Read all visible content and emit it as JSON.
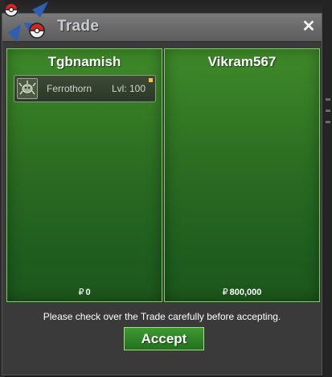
{
  "window": {
    "title": "Trade",
    "close_label": "✕"
  },
  "left_panel": {
    "name": "Tgbnamish",
    "items": [
      {
        "name": "Ferrothorn",
        "level": "Lvl: 100"
      }
    ],
    "money_symbol": "₽",
    "money": "0"
  },
  "right_panel": {
    "name": "Vikram567",
    "money_symbol": "₽",
    "money": "800,000"
  },
  "notice": "Please check over the Trade carefully before accepting.",
  "accept_label": "Accept",
  "colors": {
    "panel_green": "#2c6d22",
    "panel_border": "#7cd061",
    "badge": "#f4c631"
  },
  "icons": {
    "logo": "pokeball-logo-icon",
    "item": "ferrothorn-sprite-icon",
    "close": "close-icon"
  }
}
